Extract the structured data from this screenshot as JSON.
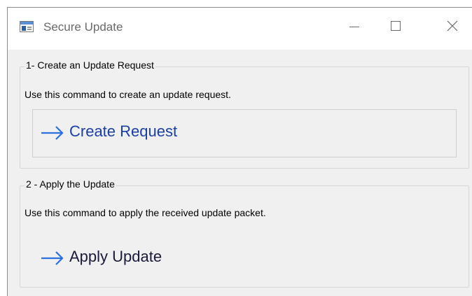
{
  "window": {
    "title": "Secure Update",
    "controls": {
      "minimize_icon": "minimize-icon",
      "maximize_icon": "maximize-icon",
      "close_icon": "close-icon"
    }
  },
  "groups": [
    {
      "legend": "1- Create an Update Request",
      "description": "Use this command to create an update request.",
      "command_label": "Create Request",
      "icon": "arrow-right-icon"
    },
    {
      "legend": "2 - Apply the Update",
      "description": "Use this command to apply the received update packet.",
      "command_label": "Apply Update",
      "icon": "arrow-right-icon"
    }
  ],
  "colors": {
    "arrow": "#2b6fe0",
    "window_bg": "#f0f0f0",
    "titlebar_bg": "#ffffff"
  }
}
